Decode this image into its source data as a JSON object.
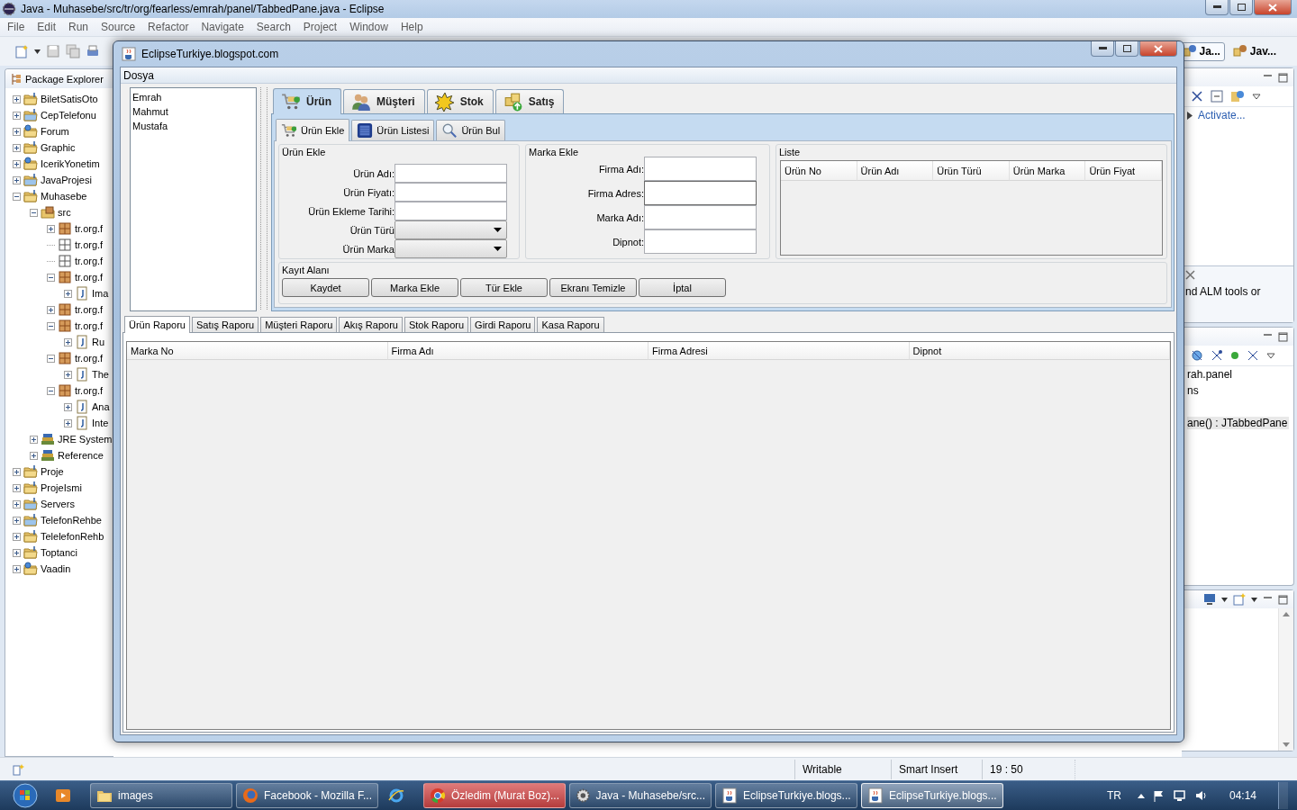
{
  "window": {
    "title": "Java - Muhasebe/src/tr/org/fearless/emrah/panel/TabbedPane.java - Eclipse"
  },
  "menu": [
    "File",
    "Edit",
    "Run",
    "Source",
    "Refactor",
    "Navigate",
    "Search",
    "Project",
    "Window",
    "Help"
  ],
  "perspectives": [
    {
      "label": "Ja...",
      "selected": true
    },
    {
      "label": "Jav...",
      "selected": false
    }
  ],
  "package_explorer": {
    "title": "Package Explorer",
    "items": [
      {
        "label": "BiletSatisOto",
        "kind": "project",
        "expanded": false
      },
      {
        "label": "CepTelefonu",
        "kind": "plain-project",
        "expanded": false
      },
      {
        "label": "Forum",
        "kind": "web-project",
        "expanded": false
      },
      {
        "label": "Graphic",
        "kind": "project",
        "expanded": false
      },
      {
        "label": "IcerikYonetim",
        "kind": "web-project",
        "expanded": false
      },
      {
        "label": "JavaProjesi",
        "kind": "plain-project",
        "expanded": false
      },
      {
        "label": "Muhasebe",
        "kind": "project",
        "expanded": true,
        "children": [
          {
            "label": "src",
            "kind": "source-folder",
            "expanded": true,
            "children": [
              {
                "label": "tr.org.f",
                "kind": "package",
                "expanded": false
              },
              {
                "label": "tr.org.f",
                "kind": "empty-package"
              },
              {
                "label": "tr.org.f",
                "kind": "empty-package"
              },
              {
                "label": "tr.org.f",
                "kind": "package",
                "expanded": true,
                "children": [
                  {
                    "label": "Ima",
                    "kind": "java-file",
                    "expanded": false
                  }
                ]
              },
              {
                "label": "tr.org.f",
                "kind": "package",
                "expanded": false
              },
              {
                "label": "tr.org.f",
                "kind": "package",
                "expanded": true,
                "children": [
                  {
                    "label": "Ru",
                    "kind": "java-file",
                    "expanded": false
                  }
                ]
              },
              {
                "label": "tr.org.f",
                "kind": "package",
                "expanded": true,
                "children": [
                  {
                    "label": "The",
                    "kind": "java-file",
                    "expanded": false
                  }
                ]
              },
              {
                "label": "tr.org.f",
                "kind": "package",
                "expanded": true,
                "children": [
                  {
                    "label": "Ana",
                    "kind": "java-file",
                    "expanded": false
                  },
                  {
                    "label": "Inte",
                    "kind": "java-file",
                    "expanded": false
                  }
                ]
              }
            ]
          },
          {
            "label": "JRE System",
            "kind": "library",
            "expanded": false
          },
          {
            "label": "Reference",
            "kind": "library",
            "expanded": false
          }
        ]
      },
      {
        "label": "Proje",
        "kind": "project",
        "expanded": false
      },
      {
        "label": "ProjeIsmi",
        "kind": "project",
        "expanded": false
      },
      {
        "label": "Servers",
        "kind": "plain-project",
        "expanded": false
      },
      {
        "label": "TelefonRehbe",
        "kind": "plain-project",
        "expanded": false
      },
      {
        "label": "TelelefonRehb",
        "kind": "project",
        "expanded": false
      },
      {
        "label": "Toptanci",
        "kind": "project",
        "expanded": false
      },
      {
        "label": "Vaadin",
        "kind": "web-project",
        "expanded": false
      }
    ]
  },
  "task_list": {
    "link": "Activate...",
    "note": "nd ALM tools or"
  },
  "outline": {
    "lines": [
      {
        "text": "rah.panel",
        "selected": false
      },
      {
        "text": "ns",
        "selected": false
      },
      {
        "text": "ane() : JTabbedPane",
        "selected": true
      }
    ]
  },
  "dialog": {
    "title": "EclipseTurkiye.blogspot.com",
    "menu": [
      "Dosya"
    ],
    "names": [
      "Emrah",
      "Mahmut",
      "Mustafa"
    ],
    "tabs": [
      {
        "label": "Ürün",
        "kind": "cart",
        "selected": true
      },
      {
        "label": "Müşteri",
        "kind": "people",
        "selected": false
      },
      {
        "label": "Stok",
        "kind": "star",
        "selected": false
      },
      {
        "label": "Satış",
        "kind": "boxes",
        "selected": false
      }
    ],
    "subtabs": [
      {
        "label": "Ürün Ekle",
        "kind": "cart",
        "selected": true
      },
      {
        "label": "Ürün Listesi",
        "kind": "list",
        "selected": false
      },
      {
        "label": "Ürün Bul",
        "kind": "search",
        "selected": false
      }
    ],
    "product_form": {
      "title": "Ürün Ekle",
      "fields": [
        {
          "label": "Ürün Adı:",
          "kind": "text"
        },
        {
          "label": "Ürün Fiyatı:",
          "kind": "text"
        },
        {
          "label": "Ürün Ekleme Tarihi:",
          "kind": "text"
        },
        {
          "label": "Ürün Türü",
          "kind": "combo"
        },
        {
          "label": "Ürün Marka",
          "kind": "combo"
        }
      ]
    },
    "brand_form": {
      "title": "Marka Ekle",
      "fields": [
        {
          "label": "Firma Adı:",
          "focused": false
        },
        {
          "label": "Firma Adres:",
          "focused": true
        },
        {
          "label": "Marka Adı:",
          "focused": false
        },
        {
          "label": "Dipnot:",
          "focused": false
        }
      ]
    },
    "list": {
      "title": "Liste",
      "columns": [
        "Ürün No",
        "Ürün Adı",
        "Ürün Türü",
        "Ürün Marka",
        "Ürün Fiyat"
      ]
    },
    "save_area": {
      "title": "Kayıt Alanı",
      "buttons": [
        "Kaydet",
        "Marka Ekle",
        "Tür Ekle",
        "Ekranı Temizle",
        "İptal"
      ]
    },
    "report_tabs": [
      {
        "label": "Ürün Raporu",
        "selected": true
      },
      {
        "label": "Satış Raporu",
        "selected": false
      },
      {
        "label": "Müşteri Raporu",
        "selected": false
      },
      {
        "label": "Akış Raporu",
        "selected": false
      },
      {
        "label": "Stok Raporu",
        "selected": false
      },
      {
        "label": "Girdi Raporu",
        "selected": false
      },
      {
        "label": "Kasa Raporu",
        "selected": false
      }
    ],
    "report_table": {
      "columns": [
        "Marka No",
        "Firma Adı",
        "Firma Adresi",
        "Dipnot"
      ]
    }
  },
  "status_bar": {
    "fields": [
      "Writable",
      "Smart Insert",
      "19 : 50"
    ]
  },
  "taskbar": {
    "items": [
      {
        "kind": "media",
        "selected": false,
        "highlighted": false
      },
      {
        "kind": "folder",
        "label": "images",
        "selected": false,
        "highlighted": false
      },
      {
        "kind": "firefox",
        "label": "Facebook - Mozilla F...",
        "selected": false,
        "highlighted": false
      },
      {
        "kind": "ie",
        "selected": false,
        "highlighted": false
      },
      {
        "kind": "chrome",
        "label": "Özledim (Murat Boz)...",
        "selected": false,
        "highlighted": true
      },
      {
        "kind": "eclipse",
        "label": "Java - Muhasebe/src...",
        "selected": false,
        "highlighted": false
      },
      {
        "kind": "java",
        "label": "EclipseTurkiye.blogs...",
        "selected": false,
        "highlighted": false
      },
      {
        "kind": "java",
        "label": "EclipseTurkiye.blogs...",
        "selected": true,
        "highlighted": false
      }
    ],
    "language": "TR",
    "clock": "04:14"
  }
}
